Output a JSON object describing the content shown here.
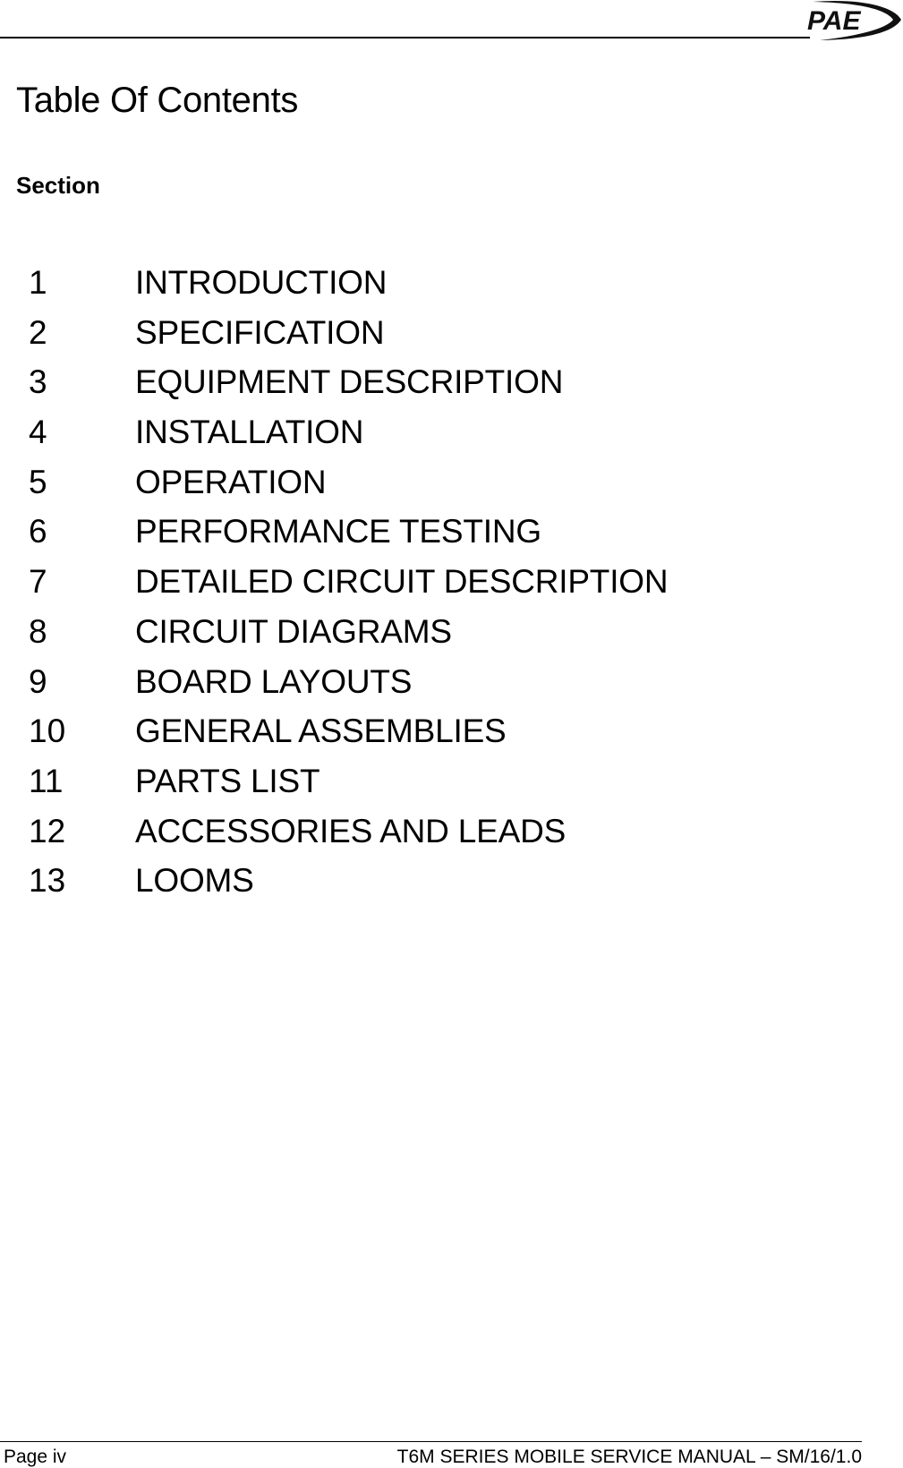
{
  "header": {
    "logo_text": "PAE",
    "logo_icon": "pae-logo-icon"
  },
  "title": "Table Of Contents",
  "section_label": "Section",
  "toc": [
    {
      "number": "1",
      "title": "INTRODUCTION"
    },
    {
      "number": "2",
      "title": "SPECIFICATION"
    },
    {
      "number": "3",
      "title": "EQUIPMENT DESCRIPTION"
    },
    {
      "number": "4",
      "title": "INSTALLATION"
    },
    {
      "number": "5",
      "title": "OPERATION"
    },
    {
      "number": "6",
      "title": "PERFORMANCE TESTING"
    },
    {
      "number": "7",
      "title": "DETAILED CIRCUIT DESCRIPTION"
    },
    {
      "number": "8",
      "title": "CIRCUIT DIAGRAMS"
    },
    {
      "number": "9",
      "title": "BOARD LAYOUTS"
    },
    {
      "number": "10",
      "title": "GENERAL ASSEMBLIES"
    },
    {
      "number": "11",
      "title": "PARTS LIST"
    },
    {
      "number": "12",
      "title": "ACCESSORIES AND LEADS"
    },
    {
      "number": "13",
      "title": "LOOMS"
    }
  ],
  "footer": {
    "page": "Page iv",
    "manual": "T6M SERIES MOBILE SERVICE MANUAL – SM/16/1.0"
  }
}
